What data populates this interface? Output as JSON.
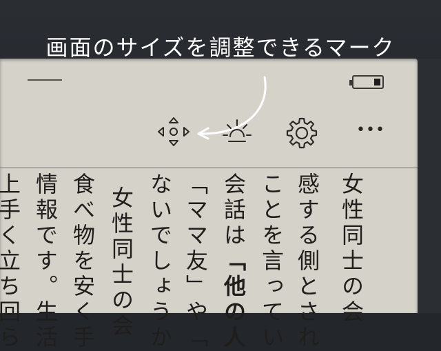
{
  "caption": "画面のサイズを調整できるマーク",
  "toolbar": {
    "resize_icon": "resize-arrows-icon",
    "brightness_icon": "brightness-icon",
    "settings_icon": "gear-icon",
    "more_label": "•••"
  },
  "text_columns": [
    "女性同士の会",
    "感する側とされ",
    "ことを言ってい",
    "会話は",
    "「他の人",
    "「ママ友」や「",
    "ないでしょうか",
    "女性同士の会",
    "食べ物を安く手",
    "情報です。生活",
    "上手く立ち回ら"
  ]
}
